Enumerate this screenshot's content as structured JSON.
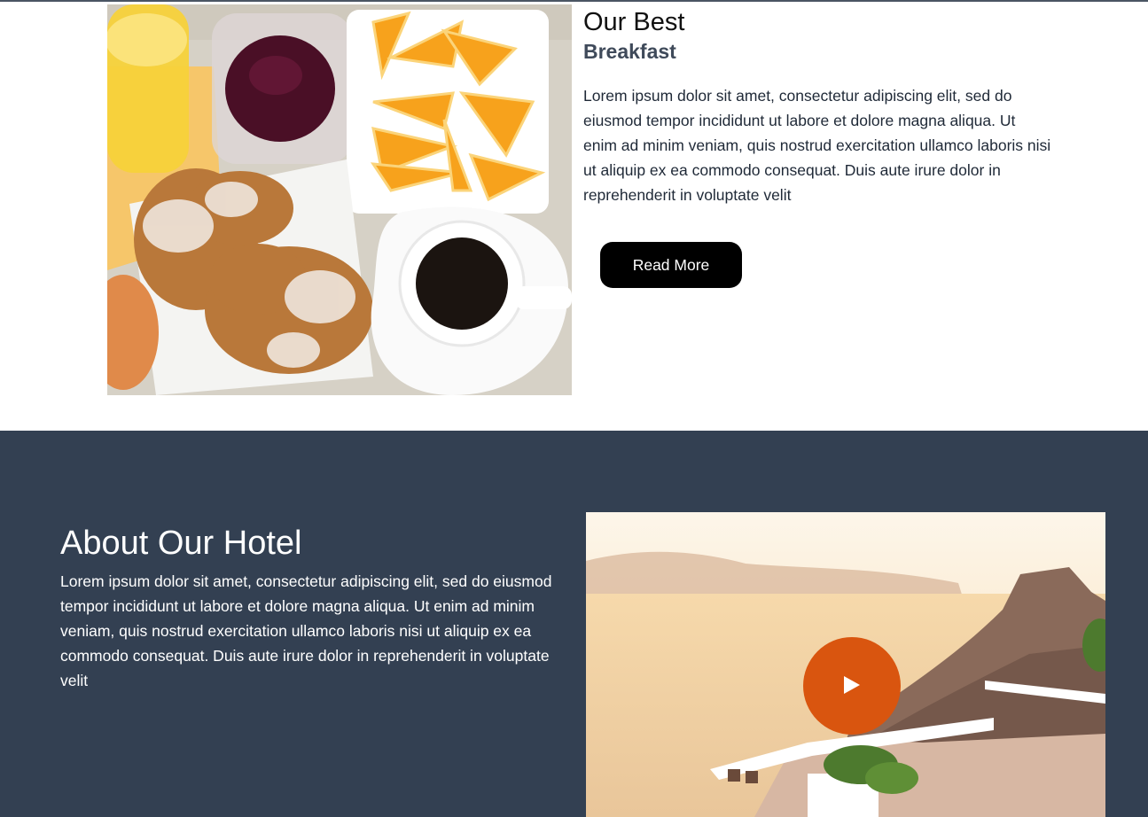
{
  "breakfast": {
    "title": "Our Best",
    "subtitle": "Breakfast",
    "body": "Lorem ipsum dolor sit amet, consectetur adipiscing elit, sed do eiusmod tempor incididunt ut labore et dolore magna aliqua. Ut enim ad minim veniam, quis nostrud exercitation ullamco laboris nisi ut aliquip ex ea commodo consequat. Duis aute irure dolor in reprehenderit in voluptate velit",
    "button_label": "Read More"
  },
  "about": {
    "title": "About Our Hotel",
    "body": "Lorem ipsum dolor sit amet, consectetur adipiscing elit, sed do eiusmod tempor incididunt ut labore et dolore magna aliqua. Ut enim ad minim veniam, quis nostrud exercitation ullamco laboris nisi ut aliquip ex ea commodo consequat. Duis aute irure dolor in reprehenderit in voluptate velit",
    "play_icon": "play-icon"
  },
  "colors": {
    "about_background": "#334052",
    "play_button": "#d9550f",
    "button_background": "#000000",
    "subtitle": "#3f4a5a"
  }
}
